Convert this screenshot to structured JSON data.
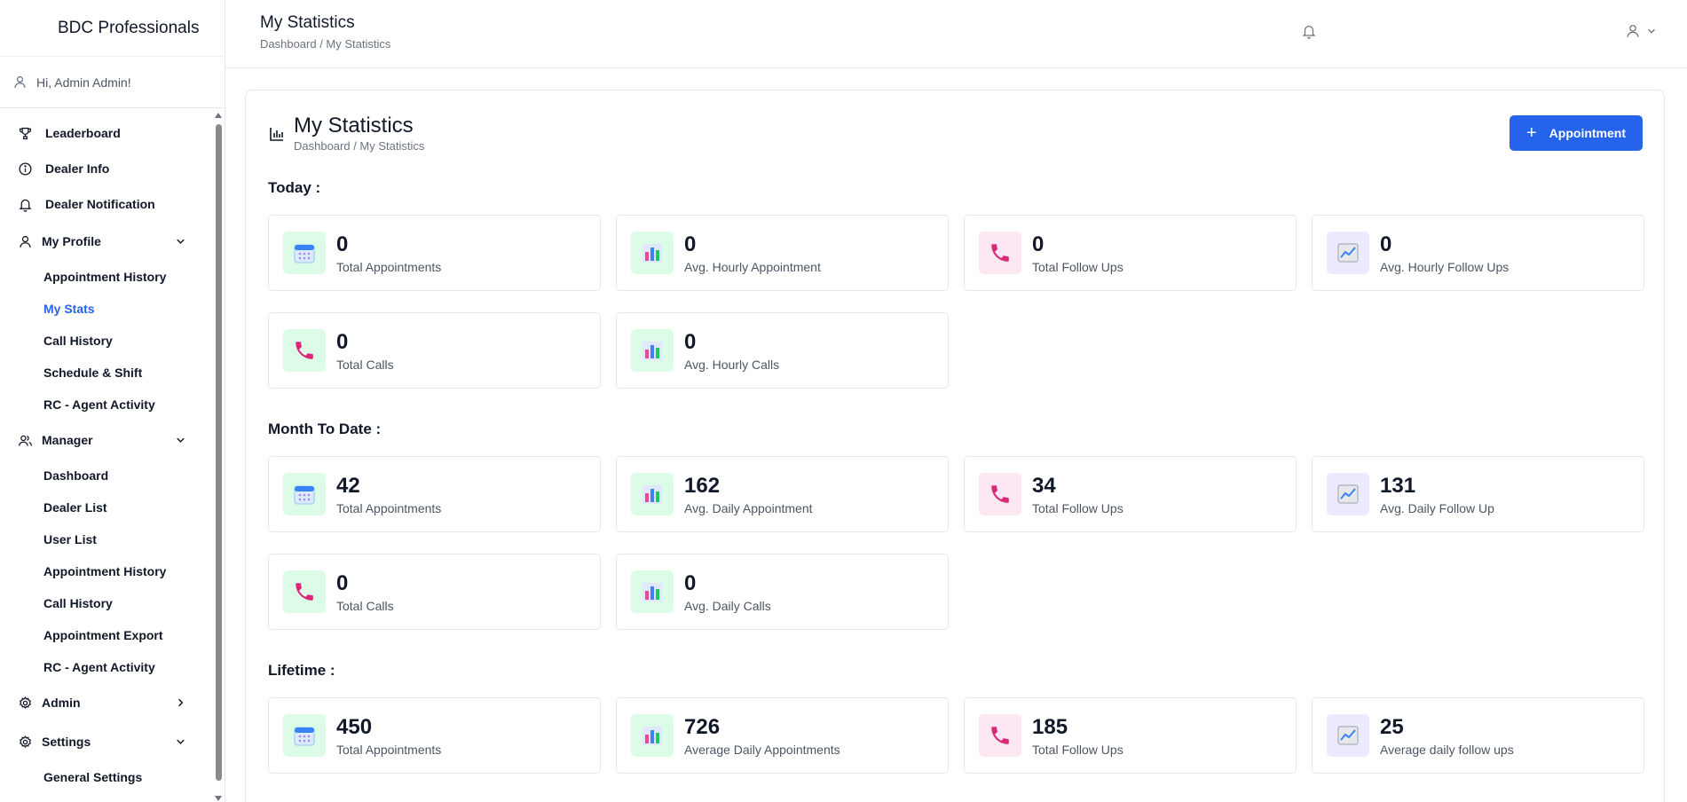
{
  "sidebar": {
    "brand": "BDC Professionals",
    "greeting": "Hi, Admin Admin!",
    "top_items": [
      {
        "label": "Leaderboard",
        "icon": "trophy-icon"
      },
      {
        "label": "Dealer Info",
        "icon": "info-icon"
      },
      {
        "label": "Dealer Notification",
        "icon": "bell-icon"
      }
    ],
    "my_profile": {
      "label": "My Profile",
      "items": [
        "Appointment History",
        "My Stats",
        "Call History",
        "Schedule & Shift",
        "RC - Agent Activity"
      ]
    },
    "manager": {
      "label": "Manager",
      "items": [
        "Dashboard",
        "Dealer List",
        "User List",
        "Appointment History",
        "Call History",
        "Appointment Export",
        "RC - Agent Activity"
      ]
    },
    "admin": {
      "label": "Admin"
    },
    "settings": {
      "label": "Settings",
      "items": [
        "General Settings"
      ]
    },
    "active_item": "My Stats"
  },
  "header": {
    "title": "My Statistics",
    "breadcrumb": "Dashboard / My Statistics"
  },
  "page": {
    "title": "My Statistics",
    "breadcrumb": "Dashboard / My Statistics",
    "appointment_button": "Appointment"
  },
  "sections": {
    "today": {
      "label": "Today :",
      "stats": [
        {
          "value": "0",
          "label": "Total Appointments",
          "icon": "calendar-icon"
        },
        {
          "value": "0",
          "label": "Avg. Hourly Appointment",
          "icon": "bar-chart-icon"
        },
        {
          "value": "0",
          "label": "Total Follow Ups",
          "icon": "phone-icon"
        },
        {
          "value": "0",
          "label": "Avg. Hourly Follow Ups",
          "icon": "trend-chart-icon"
        },
        {
          "value": "0",
          "label": "Total Calls",
          "icon": "phone-icon"
        },
        {
          "value": "0",
          "label": "Avg. Hourly Calls",
          "icon": "bar-chart-icon"
        }
      ]
    },
    "month": {
      "label": "Month To Date :",
      "stats": [
        {
          "value": "42",
          "label": "Total Appointments",
          "icon": "calendar-icon"
        },
        {
          "value": "162",
          "label": "Avg. Daily Appointment",
          "icon": "bar-chart-icon"
        },
        {
          "value": "34",
          "label": "Total Follow Ups",
          "icon": "phone-icon"
        },
        {
          "value": "131",
          "label": "Avg. Daily Follow Up",
          "icon": "trend-chart-icon"
        },
        {
          "value": "0",
          "label": "Total Calls",
          "icon": "phone-icon"
        },
        {
          "value": "0",
          "label": "Avg. Daily Calls",
          "icon": "bar-chart-icon"
        }
      ]
    },
    "lifetime": {
      "label": "Lifetime :",
      "stats": [
        {
          "value": "450",
          "label": "Total Appointments",
          "icon": "calendar-icon"
        },
        {
          "value": "726",
          "label": "Average Daily Appointments",
          "icon": "bar-chart-icon"
        },
        {
          "value": "185",
          "label": "Total Follow Ups",
          "icon": "phone-icon"
        },
        {
          "value": "25",
          "label": "Average daily follow ups",
          "icon": "trend-chart-icon"
        }
      ]
    }
  },
  "colors": {
    "accent": "#2563eb",
    "green_tile": "#dcfce7",
    "pink_tile": "#fce7f3",
    "purple_tile": "#ede9fe",
    "phone": "#db2777"
  }
}
